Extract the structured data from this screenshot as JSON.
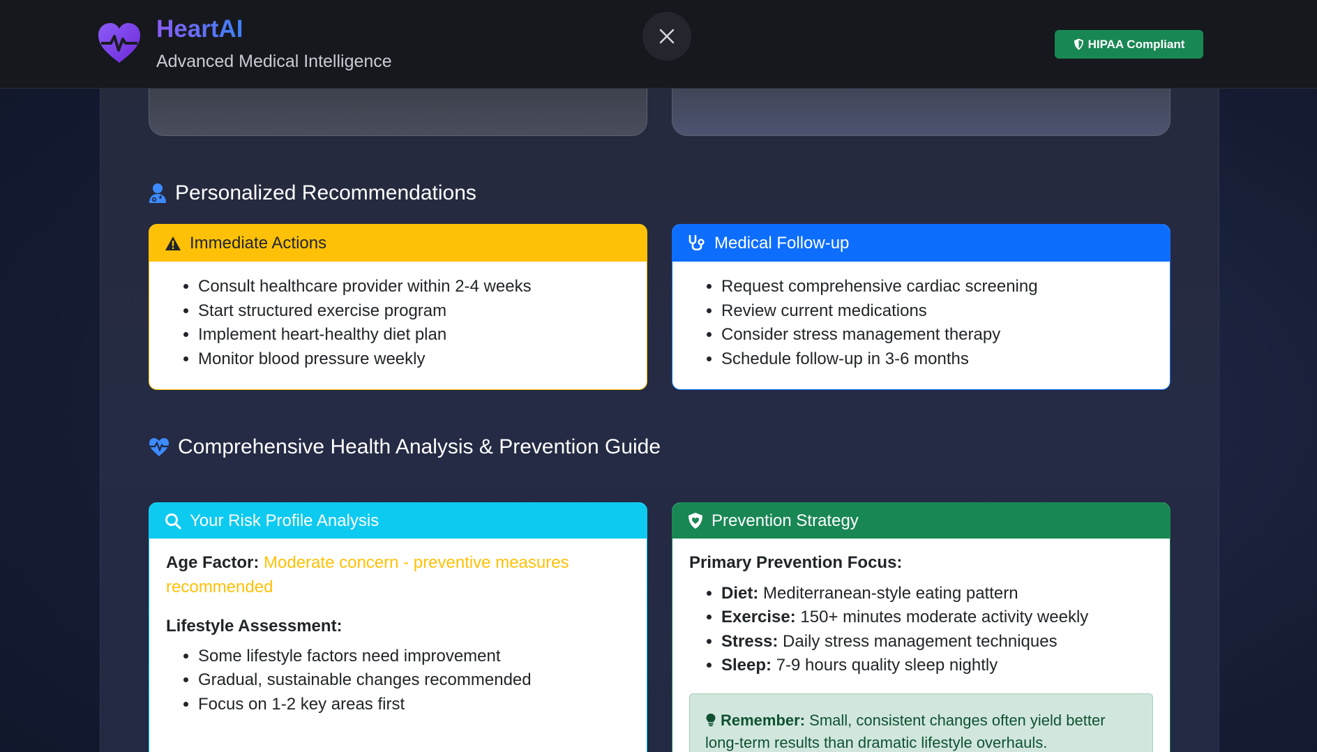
{
  "header": {
    "brand_title": "HeartAI",
    "brand_subtitle": "Advanced Medical Intelligence",
    "close_label": "×",
    "hipaa_label": "HIPAA Compliant"
  },
  "recommendations": {
    "title": "Personalized Recommendations",
    "immediate": {
      "title": "Immediate Actions",
      "items": [
        "Consult healthcare provider within 2-4 weeks",
        "Start structured exercise program",
        "Implement heart-healthy diet plan",
        "Monitor blood pressure weekly"
      ]
    },
    "followup": {
      "title": "Medical Follow-up",
      "items": [
        "Request comprehensive cardiac screening",
        "Review current medications",
        "Consider stress management therapy",
        "Schedule follow-up in 3-6 months"
      ]
    }
  },
  "analysis": {
    "title": "Comprehensive Health Analysis & Prevention Guide",
    "risk": {
      "title": "Your Risk Profile Analysis",
      "age_label": "Age Factor:",
      "age_value": "Moderate concern - preventive measures recommended",
      "lifestyle_label": "Lifestyle Assessment:",
      "items": [
        "Some lifestyle factors need improvement",
        "Gradual, sustainable changes recommended",
        "Focus on 1-2 key areas first"
      ]
    },
    "prevention": {
      "title": "Prevention Strategy",
      "focus_label": "Primary Prevention Focus:",
      "items": [
        {
          "label": "Diet:",
          "text": "Mediterranean-style eating pattern"
        },
        {
          "label": "Exercise:",
          "text": "150+ minutes moderate activity weekly"
        },
        {
          "label": "Stress:",
          "text": "Daily stress management techniques"
        },
        {
          "label": "Sleep:",
          "text": "7-9 hours quality sleep nightly"
        }
      ],
      "note_label": "Remember:",
      "note_text": "Small, consistent changes often yield better long-term results than dramatic lifestyle overhauls."
    }
  },
  "colors": {
    "warning": "#ffc107",
    "primary": "#0d6efd",
    "info": "#0dcaf0",
    "success": "#198754"
  },
  "icons": {
    "logo": "heart-pulse-icon",
    "close": "close-icon",
    "hipaa": "shield-icon",
    "recommendations": "user-doctor-icon",
    "immediate": "warning-triangle-icon",
    "followup": "stethoscope-icon",
    "analysis": "heart-pulse-icon",
    "risk": "search-icon",
    "prevention": "shield-heart-icon",
    "note": "lightbulb-icon"
  }
}
